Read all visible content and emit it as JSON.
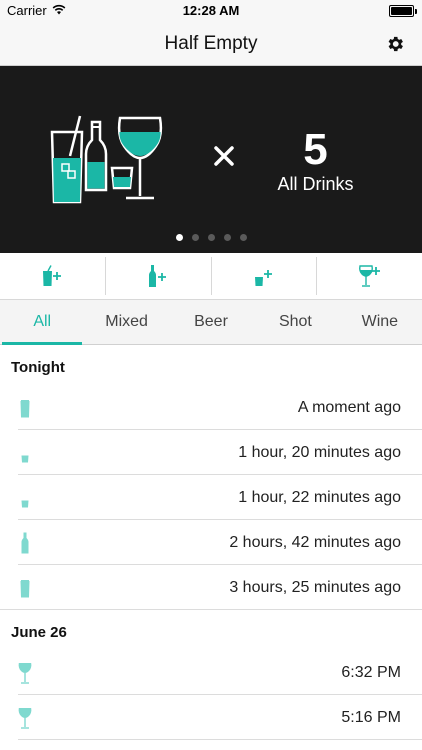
{
  "status_bar": {
    "carrier": "Carrier",
    "time": "12:28 AM"
  },
  "nav": {
    "title": "Half Empty"
  },
  "hero": {
    "times_symbol": "×",
    "count": "5",
    "label": "All Drinks",
    "pages": 5,
    "active_page": 0
  },
  "add_buttons": [
    "mixed-add",
    "beer-add",
    "shot-add",
    "wine-add"
  ],
  "tabs": [
    {
      "label": "All",
      "active": true
    },
    {
      "label": "Mixed",
      "active": false
    },
    {
      "label": "Beer",
      "active": false
    },
    {
      "label": "Shot",
      "active": false
    },
    {
      "label": "Wine",
      "active": false
    }
  ],
  "sections": [
    {
      "title": "Tonight",
      "rows": [
        {
          "icon": "mixed-drink-icon",
          "time": "A moment ago"
        },
        {
          "icon": "shot-glass-icon",
          "time": "1 hour, 20 minutes ago"
        },
        {
          "icon": "shot-glass-icon",
          "time": "1 hour, 22 minutes ago"
        },
        {
          "icon": "beer-bottle-icon",
          "time": "2 hours, 42 minutes ago"
        },
        {
          "icon": "mixed-drink-icon",
          "time": "3 hours, 25 minutes ago"
        }
      ]
    },
    {
      "title": "June 26",
      "rows": [
        {
          "icon": "wine-glass-icon",
          "time": "6:32 PM"
        },
        {
          "icon": "wine-glass-icon",
          "time": "5:16 PM"
        }
      ]
    }
  ],
  "colors": {
    "accent": "#1bb7a6",
    "hero_bg": "#1a1a1a"
  }
}
